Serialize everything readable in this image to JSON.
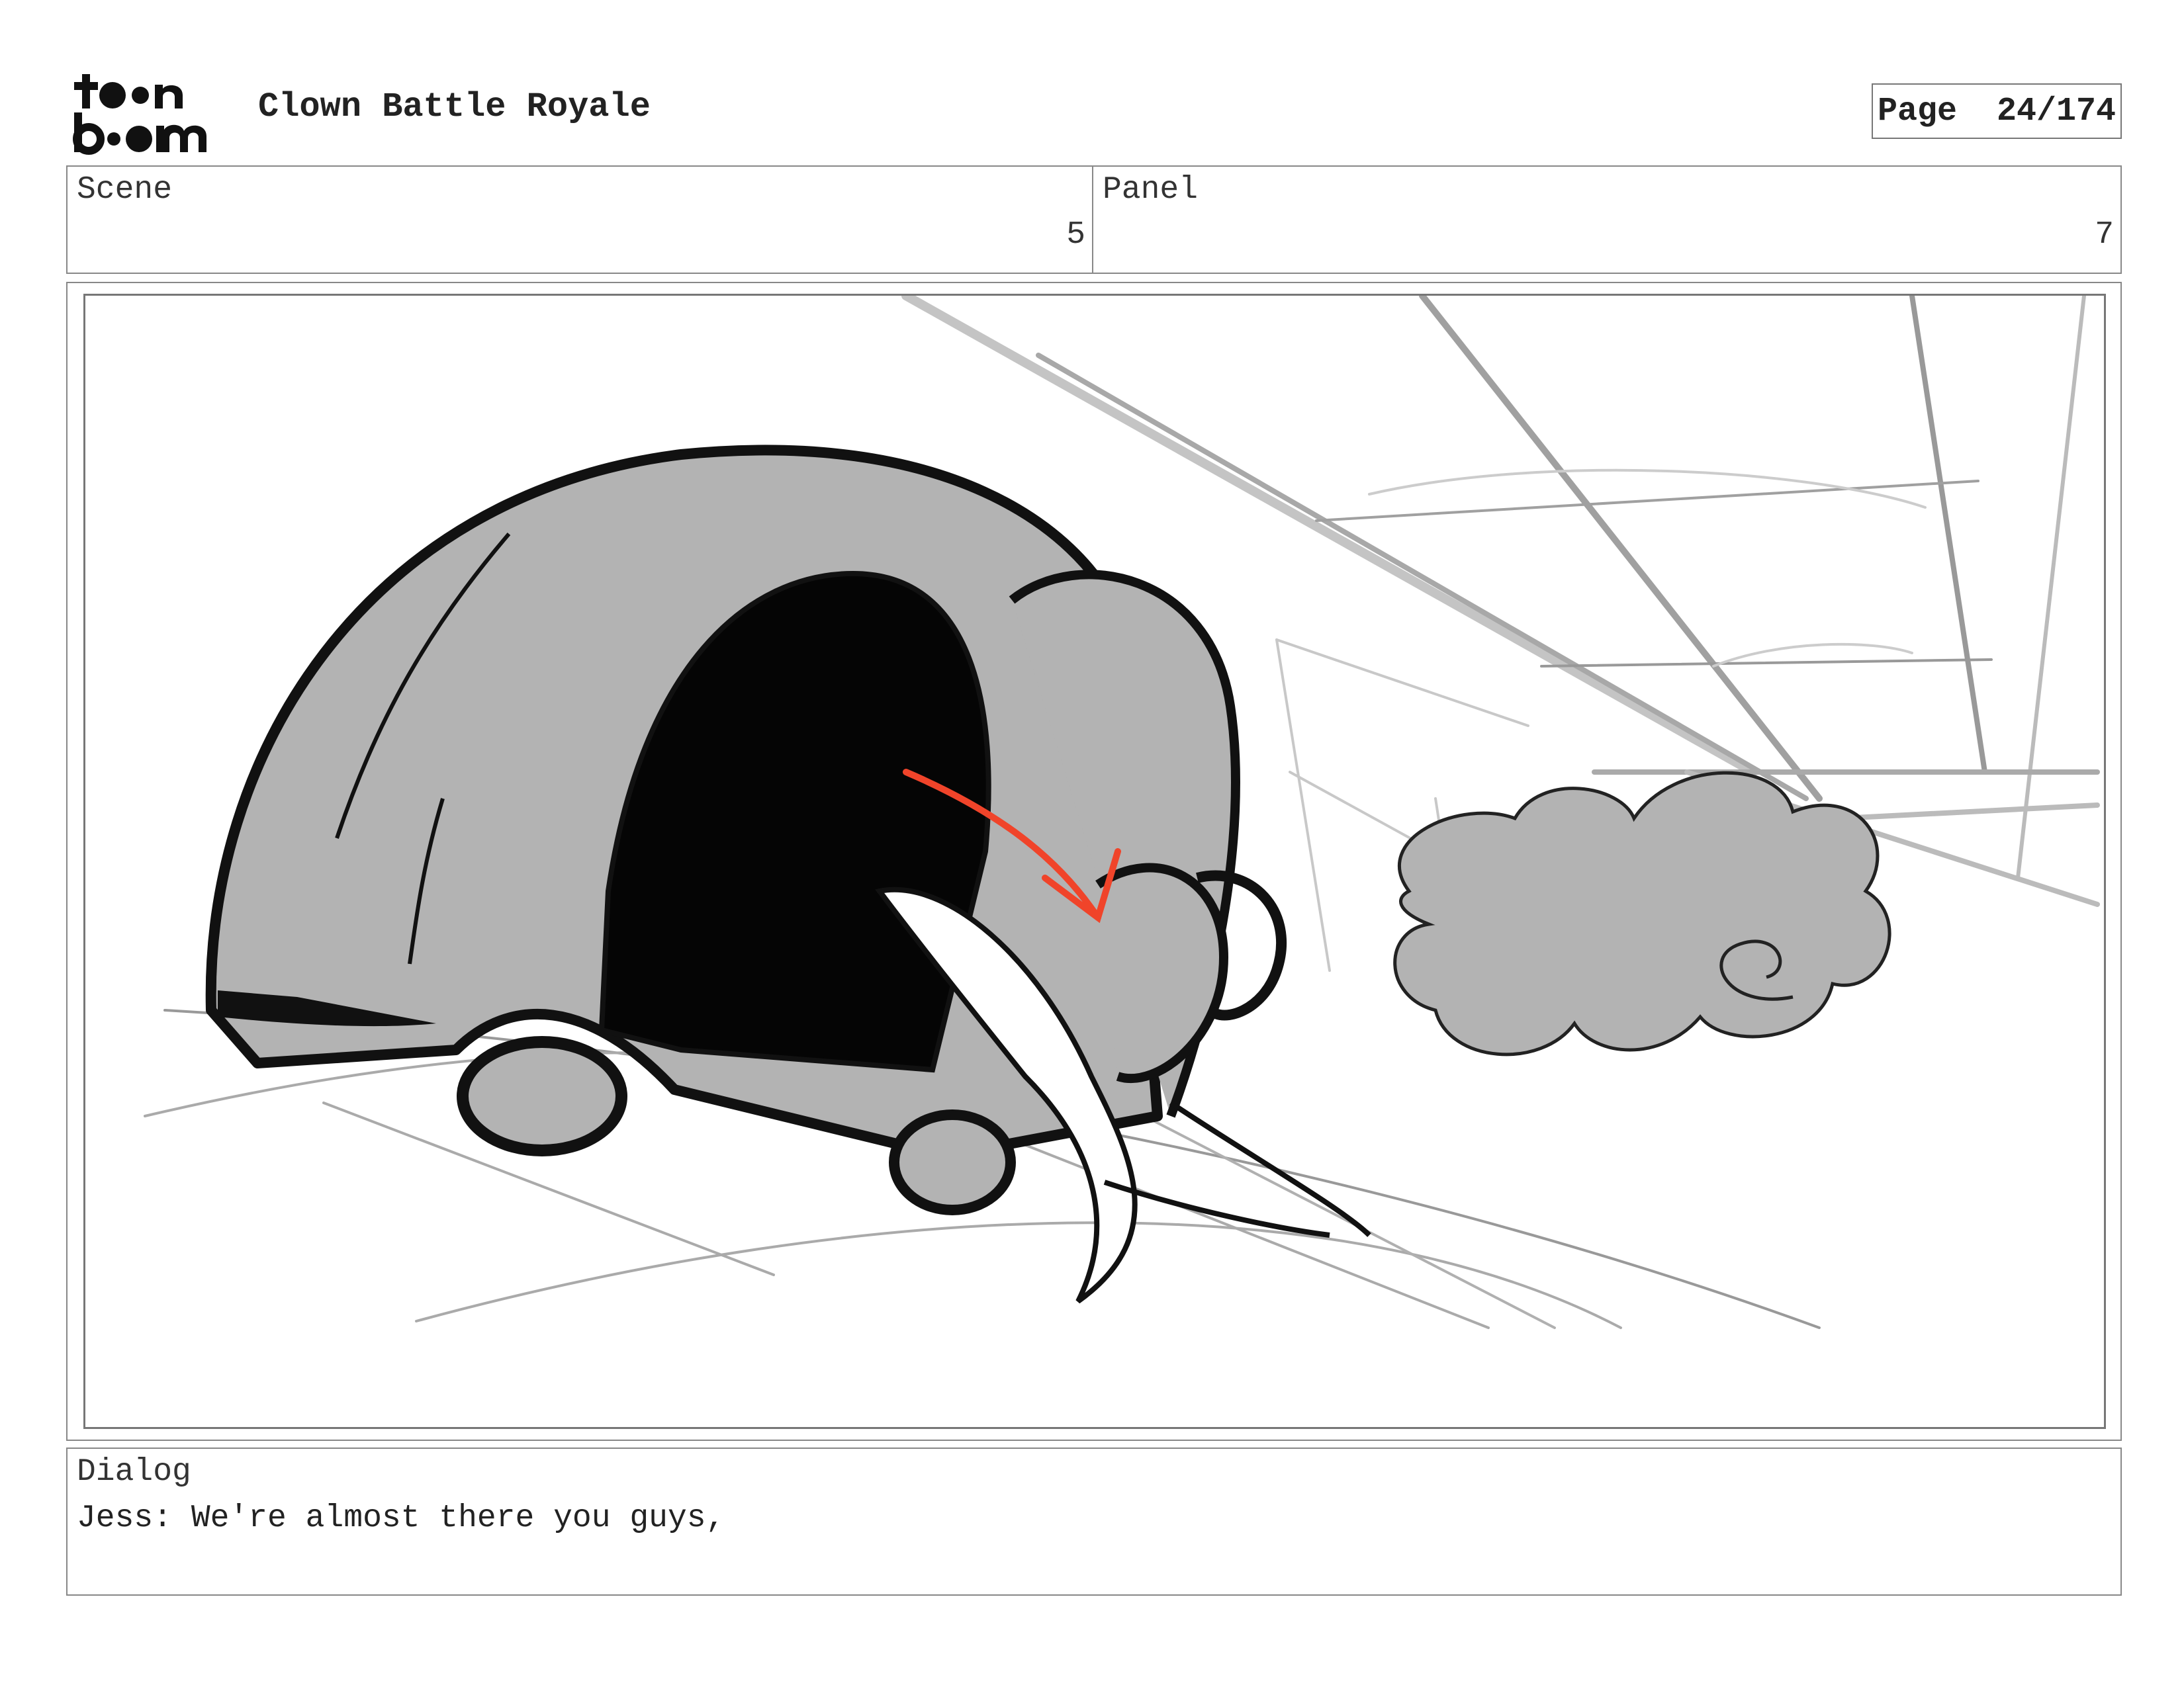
{
  "header": {
    "logo_alt": "toon boom",
    "project_title": "Clown Battle Royale",
    "page_label": "Page",
    "page_number": "24/174"
  },
  "info": {
    "scene_label": "Scene",
    "scene_value": "5",
    "panel_label": "Panel",
    "panel_value": "7"
  },
  "dialog": {
    "label": "Dialog",
    "text": "Jess: We're almost there you guys,"
  },
  "colors": {
    "border": "#888888",
    "sketch_gray": "#b3b3b3",
    "ink": "#111111",
    "arrow": "#f0442a"
  }
}
